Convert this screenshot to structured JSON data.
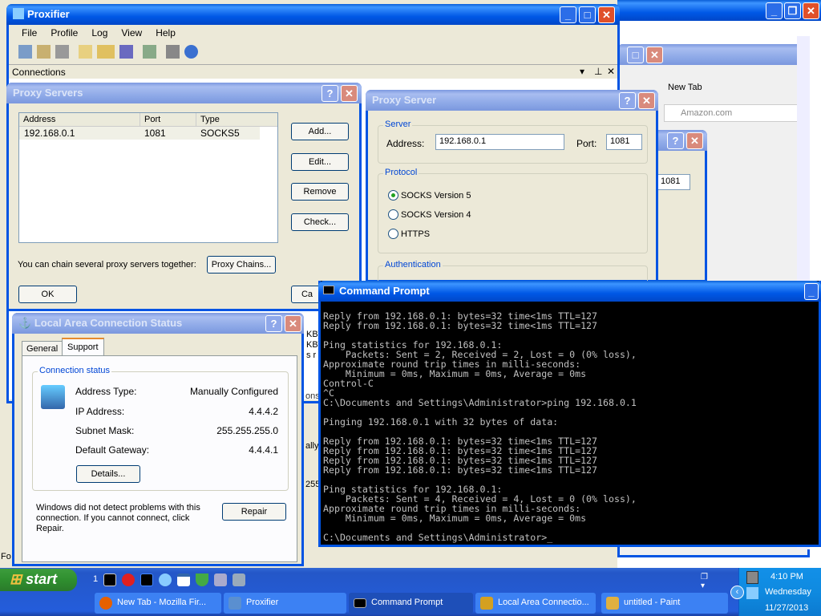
{
  "bg_window": {
    "controls": [
      "minimize",
      "restore",
      "close"
    ]
  },
  "firefox": {
    "tab": "New Tab",
    "search": "Amazon.com"
  },
  "proxifier": {
    "title": "Proxifier",
    "menu": [
      "File",
      "Profile",
      "Log",
      "View",
      "Help"
    ],
    "connections_label": "Connections"
  },
  "proxy_servers": {
    "title": "Proxy Servers",
    "columns": [
      "Address",
      "Port",
      "Type"
    ],
    "rows": [
      {
        "address": "192.168.0.1",
        "port": "1081",
        "type": "SOCKS5"
      }
    ],
    "buttons": {
      "add": "Add...",
      "edit": "Edit...",
      "remove": "Remove",
      "check": "Check..."
    },
    "chain_text": "You can chain several proxy servers together:",
    "chain_button": "Proxy Chains...",
    "ok": "OK",
    "cancel_partial": "Ca"
  },
  "proxy_server": {
    "title": "Proxy Server",
    "server_label": "Server",
    "address_label": "Address:",
    "address": "192.168.0.1",
    "port_label": "Port:",
    "port": "1081",
    "protocol_label": "Protocol",
    "protocols": [
      {
        "label": "SOCKS Version 5",
        "selected": true
      },
      {
        "label": "SOCKS Version 4",
        "selected": false
      },
      {
        "label": "HTTPS",
        "selected": false
      }
    ],
    "auth_label": "Authentication"
  },
  "behind_dialog": {
    "port": "1081"
  },
  "lan": {
    "title": "Local Area Connection Status",
    "tabs": [
      "General",
      "Support"
    ],
    "active_tab": "Support",
    "group": "Connection status",
    "rows": [
      {
        "label": "Address Type:",
        "value": "Manually Configured"
      },
      {
        "label": "IP Address:",
        "value": "4.4.4.2"
      },
      {
        "label": "Subnet Mask:",
        "value": "255.255.255.0"
      },
      {
        "label": "Default Gateway:",
        "value": "4.4.4.1"
      }
    ],
    "details": "Details...",
    "message": "Windows did not detect problems with this connection. If you cannot connect, click Repair.",
    "repair": "Repair"
  },
  "partial_texts": {
    "kb1": "KB]",
    "kb2": "KB]",
    "ons": "ons",
    "ally": "ally",
    "n255": "255",
    "fo": "Fo",
    "s_r": "s r"
  },
  "cmd": {
    "title": "Command Prompt",
    "lines": [
      "Reply from 192.168.0.1: bytes=32 time<1ms TTL=127",
      "Reply from 192.168.0.1: bytes=32 time<1ms TTL=127",
      "",
      "Ping statistics for 192.168.0.1:",
      "    Packets: Sent = 2, Received = 2, Lost = 0 (0% loss),",
      "Approximate round trip times in milli-seconds:",
      "    Minimum = 0ms, Maximum = 0ms, Average = 0ms",
      "Control-C",
      "^C",
      "C:\\Documents and Settings\\Administrator>ping 192.168.0.1",
      "",
      "Pinging 192.168.0.1 with 32 bytes of data:",
      "",
      "Reply from 192.168.0.1: bytes=32 time<1ms TTL=127",
      "Reply from 192.168.0.1: bytes=32 time<1ms TTL=127",
      "Reply from 192.168.0.1: bytes=32 time<1ms TTL=127",
      "Reply from 192.168.0.1: bytes=32 time<1ms TTL=127",
      "",
      "Ping statistics for 192.168.0.1:",
      "    Packets: Sent = 4, Received = 4, Lost = 0 (0% loss),",
      "Approximate round trip times in milli-seconds:",
      "    Minimum = 0ms, Maximum = 0ms, Average = 0ms",
      "",
      "C:\\Documents and Settings\\Administrator>_"
    ]
  },
  "taskbar": {
    "start": "start",
    "quicklaunch_count": "1",
    "items": [
      {
        "label": "New Tab - Mozilla Fir...",
        "icon": "firefox-icon",
        "color": "#e66000"
      },
      {
        "label": "Proxifier",
        "icon": "proxifier-icon",
        "color": "#5a8fd0"
      },
      {
        "label": "Command Prompt",
        "icon": "cmd-icon",
        "color": "#000000",
        "active": true
      },
      {
        "label": "Local Area Connectio...",
        "icon": "network-icon",
        "color": "#d4a020"
      },
      {
        "label": "untitled - Paint",
        "icon": "paint-icon",
        "color": "#e0b040"
      }
    ],
    "clock": {
      "time": "4:10 PM",
      "day": "Wednesday",
      "date": "11/27/2013"
    }
  }
}
